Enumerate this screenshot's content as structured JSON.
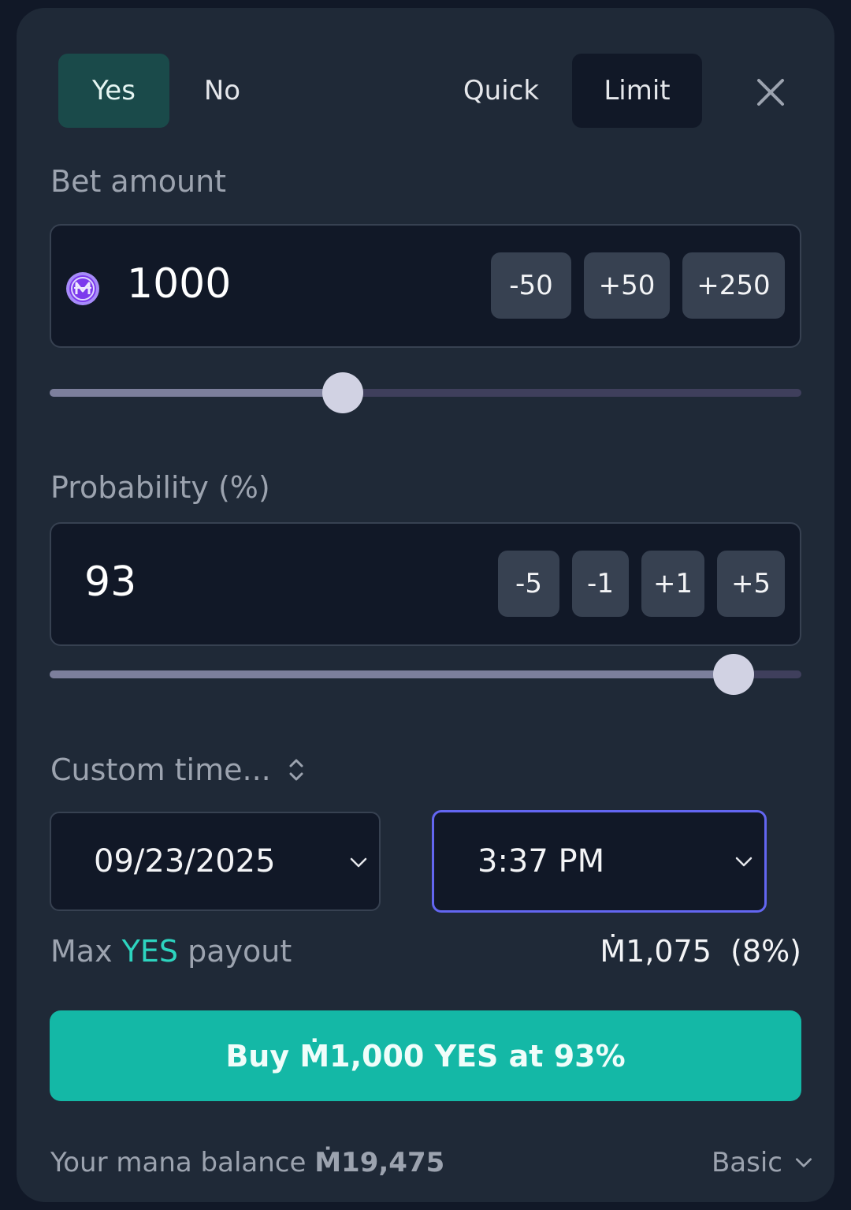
{
  "header": {
    "outcome_tabs": [
      "Yes",
      "No"
    ],
    "mode_tabs": [
      "Quick",
      "Limit"
    ]
  },
  "bet": {
    "label": "Bet amount",
    "value": "1000",
    "currency_icon": "mana-coin-icon",
    "steps": [
      "-50",
      "+50",
      "+250"
    ],
    "slider_fraction": 0.39
  },
  "probability": {
    "label": "Probability (%)",
    "value": "93",
    "steps": [
      "-5",
      "-1",
      "+1",
      "+5"
    ],
    "slider_fraction": 0.91
  },
  "expiry": {
    "label": "Custom time...",
    "date": "09/23/2025",
    "time": "3:37 PM"
  },
  "payout": {
    "label_prefix": "Max",
    "label_highlight": "YES",
    "label_suffix": "payout",
    "amount": "Ṁ1,075",
    "percent": "(8%)"
  },
  "submit": {
    "label": "Buy Ṁ1,000 YES at 93%"
  },
  "footer": {
    "balance_label": "Your mana balance",
    "balance_value": "Ṁ19,475",
    "mode": "Basic"
  },
  "colors": {
    "yes_accent": "#2dd4bf",
    "submit_bg": "#14b8a6",
    "focus_border": "#6366f1",
    "coin": "#8b5cf6"
  }
}
